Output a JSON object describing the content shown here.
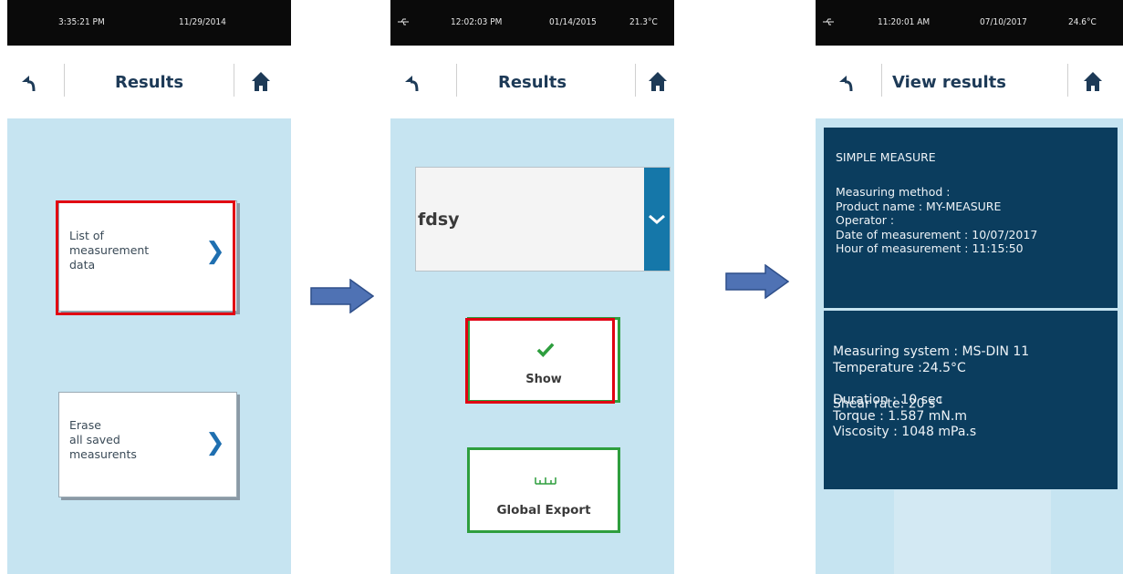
{
  "screen1": {
    "time": "3:35:21 PM",
    "date": "11/29/2014",
    "title": "Results",
    "card1_label": "List of\nmeasurement\ndata",
    "card2_label": "Erase\nall saved\nmeasurents"
  },
  "screen2": {
    "time": "12:02:03 PM",
    "date": "01/14/2015",
    "temp": "21.3°C",
    "title": "Results",
    "dropdown_value": "fdsy",
    "show_label": "Show",
    "export_label": "Global Export"
  },
  "screen3": {
    "time": "11:20:01 AM",
    "date": "07/10/2017",
    "temp": "24.6°C",
    "title": "View results",
    "panel1": {
      "heading": "SIMPLE MEASURE",
      "lines": "Measuring method :\nProduct name : MY-MEASURE\nOperator :\nDate of measurement : 10/07/2017\nHour of measurement : 11:15:50"
    },
    "panel2": {
      "lines_a": "Measuring system : MS-DIN 11\nTemperature :24.5°C",
      "shear_text": "Shear rate: 20 s",
      "shear_sup": "-1",
      "lines_b": "Duration : 10 sec\nTorque : 1.587 mN.m\nViscosity : 1048 mPa.s"
    }
  },
  "colors": {
    "screen_bg": "#c6e4f1",
    "highlight_red": "#e10012",
    "button_green": "#2e9e3e",
    "panel_navy": "#0b3d5e",
    "accent_blue": "#1577a9",
    "flow_arrow": "#4f72b4"
  },
  "icons": [
    "back-arrow-icon",
    "home-icon",
    "chevron-right-icon",
    "chevron-down-icon",
    "checkmark-icon",
    "export-ruler-icon",
    "usb-icon",
    "flow-arrow-icon"
  ]
}
